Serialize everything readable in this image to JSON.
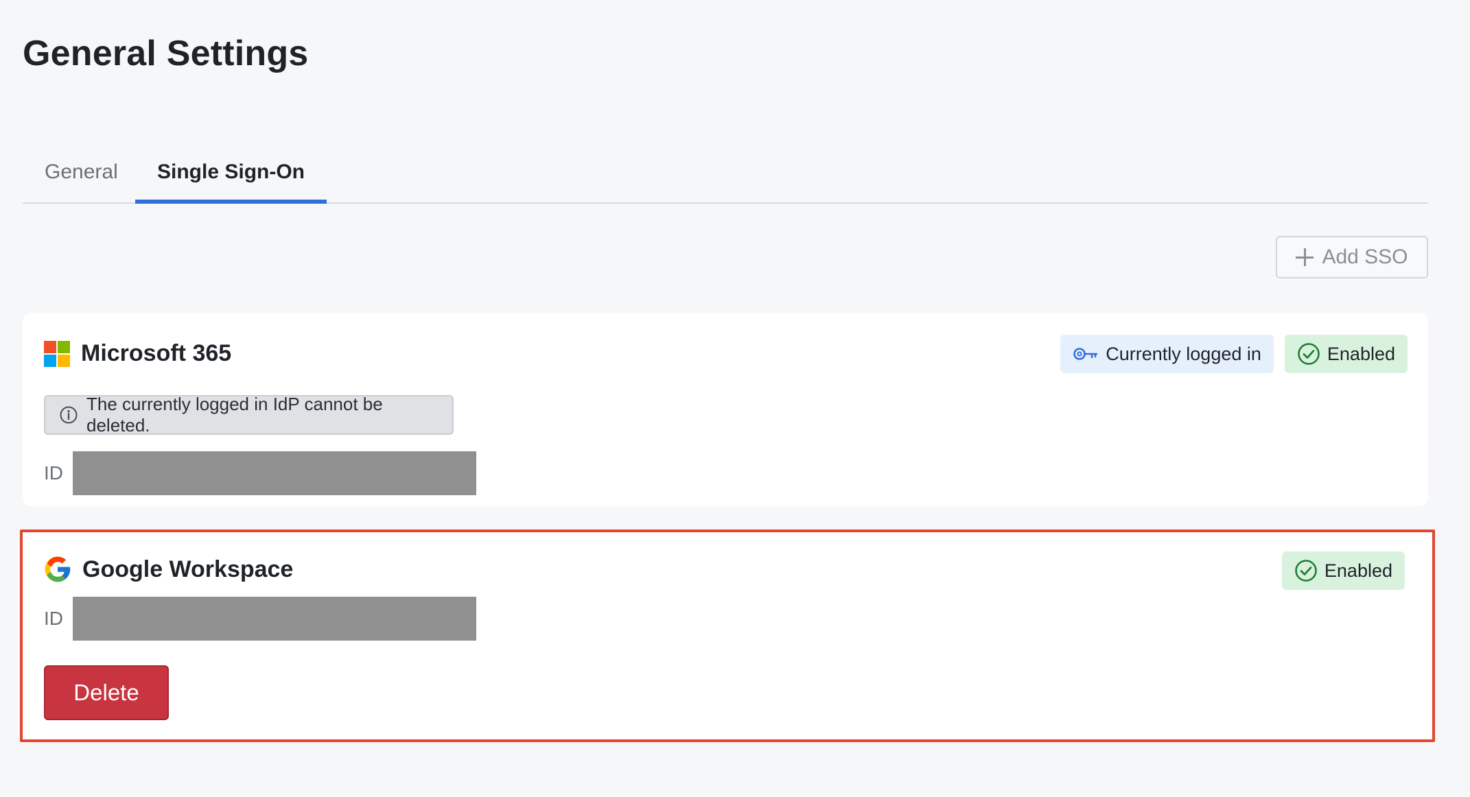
{
  "page": {
    "title": "General Settings"
  },
  "tabs": [
    {
      "label": "General",
      "active": false
    },
    {
      "label": "Single Sign-On",
      "active": true
    }
  ],
  "toolbar": {
    "add_sso_label": "Add SSO",
    "add_icon": "plus-icon"
  },
  "sso_providers": [
    {
      "name": "Microsoft 365",
      "logo": "microsoft-logo",
      "current_login_badge": "Currently logged in",
      "current_login_icon": "key-icon",
      "status": "Enabled",
      "status_icon": "check-circle-icon",
      "notice": "The currently logged in IdP cannot be deleted.",
      "notice_icon": "info-icon",
      "id_label": "ID",
      "id_value": ""
    },
    {
      "name": "Google Workspace",
      "logo": "google-logo",
      "status": "Enabled",
      "status_icon": "check-circle-icon",
      "id_label": "ID",
      "id_value": "",
      "delete_label": "Delete",
      "highlighted": true
    }
  ],
  "colors": {
    "accent_tab": "#2f6fdd",
    "highlight_border": "#e5452f",
    "delete_button": "#c8343f",
    "enabled_badge_bg": "#d9f2de",
    "login_badge_bg": "#e6f0fd",
    "redacted": "#909090"
  }
}
